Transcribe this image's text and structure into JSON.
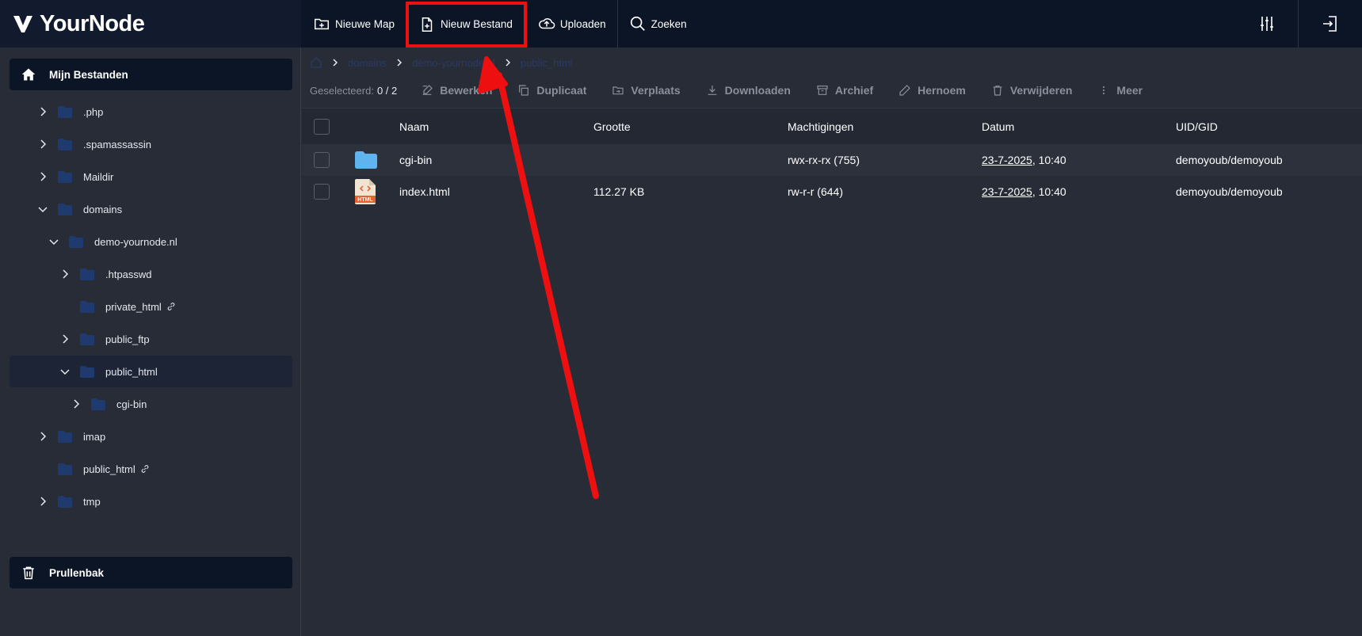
{
  "logo": {
    "text": "YourNode"
  },
  "toolbar": {
    "new_folder": "Nieuwe Map",
    "new_file": "Nieuw Bestand",
    "upload": "Uploaden",
    "search": "Zoeken"
  },
  "sidebar": {
    "my_files": "Mijn Bestanden",
    "trash": "Prullenbak",
    "tree": [
      {
        "label": ".php",
        "expanded": false,
        "has_children": true,
        "link": false,
        "depth": 0
      },
      {
        "label": ".spamassassin",
        "expanded": false,
        "has_children": true,
        "link": false,
        "depth": 0
      },
      {
        "label": "Maildir",
        "expanded": false,
        "has_children": true,
        "link": false,
        "depth": 0
      },
      {
        "label": "domains",
        "expanded": true,
        "has_children": true,
        "link": false,
        "depth": 0
      },
      {
        "label": "demo-yournode.nl",
        "expanded": true,
        "has_children": true,
        "link": false,
        "depth": 1
      },
      {
        "label": ".htpasswd",
        "expanded": false,
        "has_children": true,
        "link": false,
        "depth": 2
      },
      {
        "label": "private_html",
        "expanded": false,
        "has_children": false,
        "link": true,
        "depth": 2
      },
      {
        "label": "public_ftp",
        "expanded": false,
        "has_children": true,
        "link": false,
        "depth": 2
      },
      {
        "label": "public_html",
        "expanded": true,
        "has_children": true,
        "link": false,
        "depth": 2,
        "active": true
      },
      {
        "label": "cgi-bin",
        "expanded": false,
        "has_children": true,
        "link": false,
        "depth": 3
      },
      {
        "label": "imap",
        "expanded": false,
        "has_children": true,
        "link": false,
        "depth": 0
      },
      {
        "label": "public_html",
        "expanded": false,
        "has_children": false,
        "link": true,
        "depth": 0
      },
      {
        "label": "tmp",
        "expanded": false,
        "has_children": true,
        "link": false,
        "depth": 0
      }
    ]
  },
  "breadcrumb": [
    "domains",
    "demo-yournode.nl",
    "public_html"
  ],
  "actions": {
    "selected_label": "Geselecteerd:",
    "selected_count": "0 / 2",
    "edit": "Bewerken",
    "duplicate": "Duplicaat",
    "move": "Verplaats",
    "download": "Downloaden",
    "archive": "Archief",
    "rename": "Hernoem",
    "delete": "Verwijderen",
    "more": "Meer"
  },
  "table": {
    "columns": [
      "Naam",
      "Grootte",
      "Machtigingen",
      "Datum",
      "UID/GID"
    ],
    "rows": [
      {
        "type": "folder",
        "name": "cgi-bin",
        "size": "",
        "perm": "rwx-rx-rx (755)",
        "date": "23-7-2025",
        "time": ", 10:40",
        "uid": "demoyoub/demoyoub"
      },
      {
        "type": "html",
        "name": "index.html",
        "size": "112.27 KB",
        "perm": "rw-r-r (644)",
        "date": "23-7-2025",
        "time": ", 10:40",
        "uid": "demoyoub/demoyoub"
      }
    ]
  },
  "colors": {
    "topbar": "#0c1526",
    "background": "#282c36",
    "highlight": "#ee1010",
    "folder_blue": "#1e3a6e",
    "folder_light": "#5fb4f0"
  }
}
